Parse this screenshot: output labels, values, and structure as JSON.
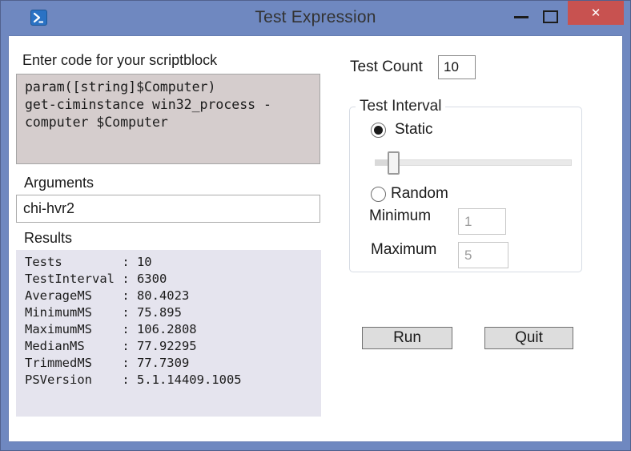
{
  "colors": {
    "titlebar_blue": "#6f88c0",
    "close_red": "#c85250",
    "code_bg": "#d5cdcd",
    "results_bg": "#e5e4ee"
  },
  "window": {
    "title": "Test Expression",
    "close_glyph": "✕"
  },
  "left": {
    "scriptblock_label": "Enter code for your scriptblock",
    "scriptblock_code": [
      "param([string]$Computer)",
      "get-ciminstance win32_process -",
      "computer $Computer"
    ],
    "arguments_label": "Arguments",
    "arguments_value": "chi-hvr2",
    "results_label": "Results",
    "results_lines": [
      "Tests        : 10",
      "TestInterval : 6300",
      "AverageMS    : 80.4023",
      "MinimumMS    : 75.895",
      "MaximumMS    : 106.2808",
      "MedianMS     : 77.92295",
      "TrimmedMS    : 77.7309",
      "PSVersion    : 5.1.14409.1005"
    ]
  },
  "right": {
    "test_count_label": "Test Count",
    "test_count_value": "10",
    "interval_group_label": "Test Interval",
    "static_label": "Static",
    "random_label": "Random",
    "minimum_label": "Minimum",
    "minimum_value": "1",
    "maximum_label": "Maximum",
    "maximum_value": "5",
    "run_label": "Run",
    "quit_label": "Quit"
  }
}
